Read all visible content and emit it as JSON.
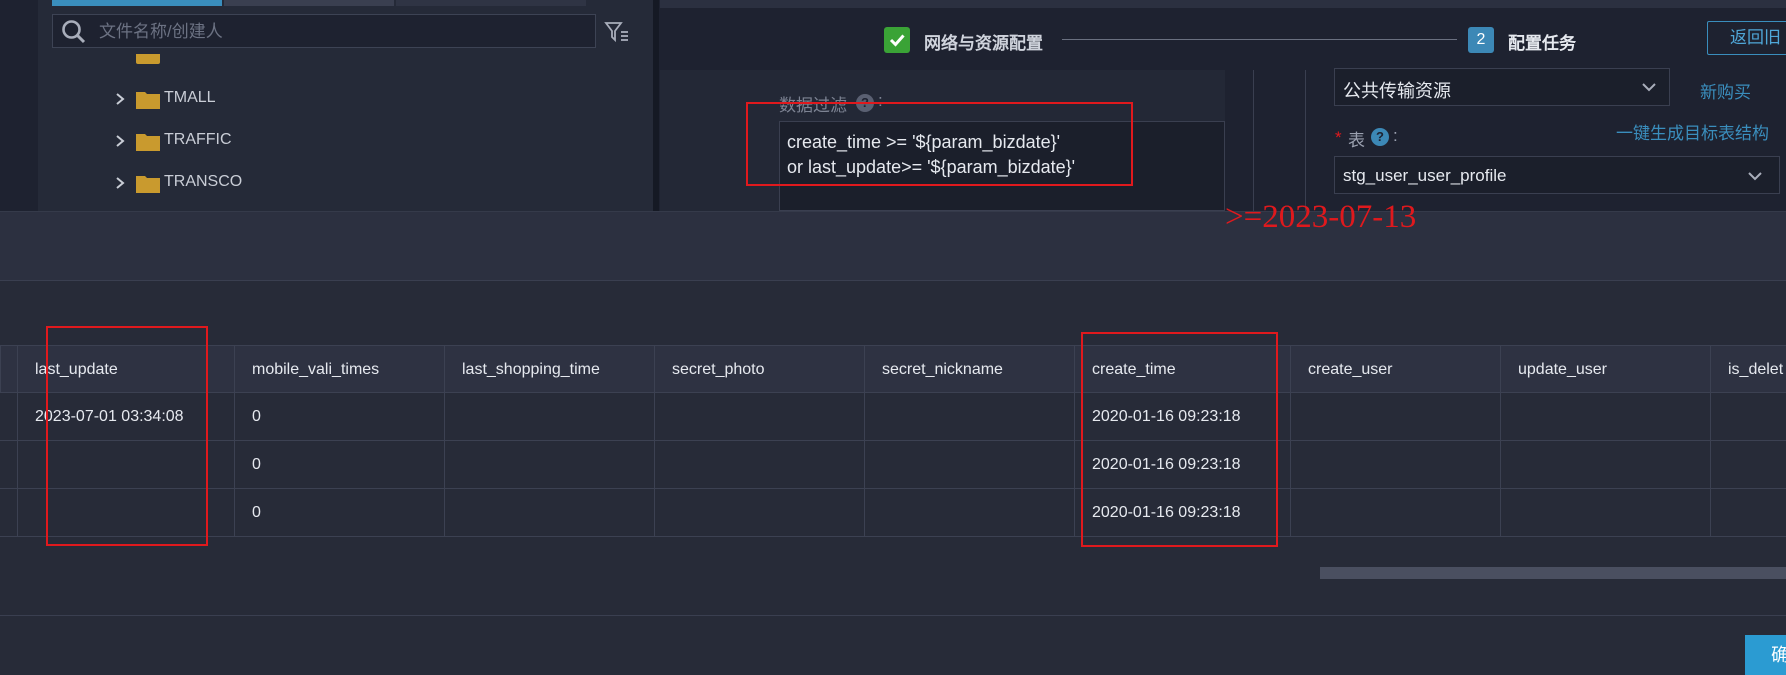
{
  "sidebar": {
    "search_placeholder": "文件名称/创建人",
    "tree": [
      "TMALL",
      "TRAFFIC",
      "TRANSCO"
    ]
  },
  "steps": [
    {
      "label": "网络与资源配置",
      "state": "done"
    },
    {
      "number": "2",
      "label": "配置任务",
      "state": "active"
    }
  ],
  "header": {
    "back_label": "返回旧"
  },
  "form": {
    "filter_label": "数据过滤",
    "filter_lines": [
      "create_time >= '${param_bizdate}'",
      "or last_update>= '${param_bizdate}'"
    ],
    "resource_group": "公共传输资源",
    "buy_new": "新购买",
    "table_label": "表",
    "table_required": "*",
    "table_value": "stg_user_user_profile",
    "generate_link": "一键生成目标表结构"
  },
  "annotation": {
    "text": ">=2023-07-13",
    "color": "#e0191d"
  },
  "table": {
    "columns": [
      "last_update",
      "mobile_vali_times",
      "last_shopping_time",
      "secret_photo",
      "secret_nickname",
      "create_time",
      "create_user",
      "update_user",
      "is_delet"
    ],
    "rows": [
      [
        "2023-07-01 03:34:08",
        "0",
        "",
        "",
        "",
        "2020-01-16 09:23:18",
        "",
        "",
        ""
      ],
      [
        "",
        "0",
        "",
        "",
        "",
        "2020-01-16 09:23:18",
        "",
        "",
        ""
      ],
      [
        "",
        "0",
        "",
        "",
        "",
        "2020-01-16 09:23:18",
        "",
        "",
        ""
      ]
    ]
  },
  "footer": {
    "confirm_label": "确"
  },
  "colors": {
    "accent": "#2b9bd2",
    "success": "#3aa336",
    "annotation_red": "#e0191d",
    "panel": "#252a38"
  }
}
